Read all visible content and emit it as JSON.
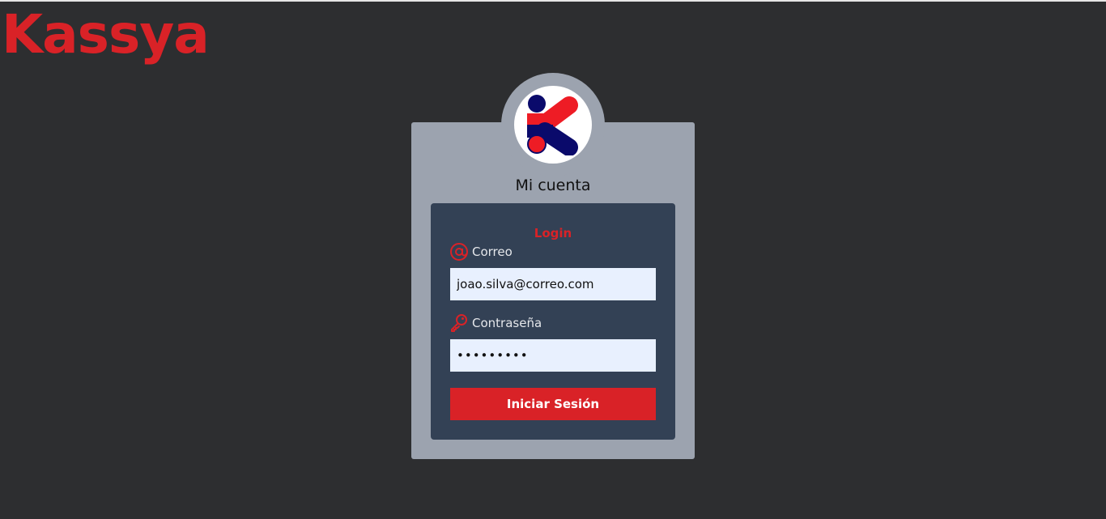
{
  "brand": {
    "name": "Kassya",
    "color": "#d92227"
  },
  "account": {
    "title": "Mi cuenta",
    "logo": "kassya-k-logo"
  },
  "login": {
    "title": "Login",
    "email_label": "Correo",
    "email_icon": "at-sign-icon",
    "email_value": "joao.silva@correo.com",
    "password_label": "Contraseña",
    "password_icon": "key-icon",
    "password_value": "•••••••••",
    "submit_label": "Iniciar Sesión"
  },
  "colors": {
    "background": "#2d2e30",
    "card": "#9ca3af",
    "panel": "#334155",
    "accent": "#d92227",
    "input_bg": "#e8f0fe"
  }
}
